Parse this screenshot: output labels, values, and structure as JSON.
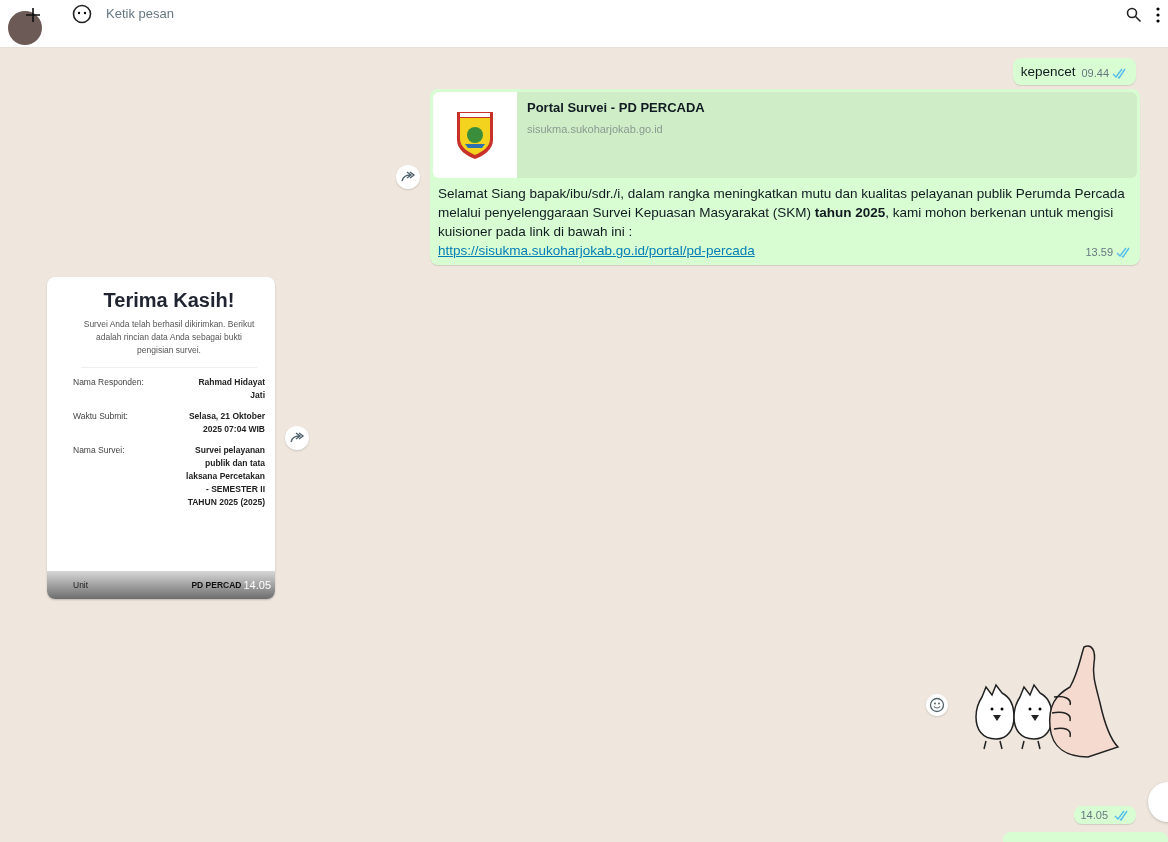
{
  "header": {
    "placeholder": "Ketik pesan"
  },
  "messages": [
    {
      "kind": "text",
      "outgoing": true,
      "text": "kepencet",
      "time": "09.44",
      "read": true
    },
    {
      "kind": "link",
      "outgoing": true,
      "forward": true,
      "preview": {
        "title": "Portal Survei - PD PERCADA",
        "domain": "sisukma.sukoharjokab.go.id"
      },
      "text": "Selamat Siang bapak/ibu/sdr./i, dalam rangka meningkatkan mutu dan kualitas pelayanan publik Perumda Percada melalui penyelenggaraan Survei Kepuasan Masyarakat (SKM) **tahun 2025**, kami mohon berkenan untuk mengisi kuisioner pada link di bawah ini :",
      "url": "https://sisukma.sukoharjokab.go.id/portal/pd-percada",
      "time": "13.59",
      "read": true
    },
    {
      "kind": "image",
      "outgoing": false,
      "forward": true,
      "time": "14.05",
      "screenshot": {
        "title": "Terima Kasih!",
        "subtitle": "Survei Anda telah berhasil dikirimkan. Berikut adalah rincian data Anda sebagai bukti pengisian survei.",
        "rows": [
          {
            "label": "Nama Responden:",
            "value": "Rahmad Hidayat Jati"
          },
          {
            "label": "Waktu Submit:",
            "value": "Selasa, 21 Oktober 2025 07:04 WIB"
          },
          {
            "label": "Nama Survei:",
            "value": "Survei pelayanan publik dan tata laksana Percetakan - SEMESTER II TAHUN 2025 (2025)"
          }
        ],
        "last_row": {
          "label": "Unit",
          "value": "PD PERCAD"
        }
      }
    },
    {
      "kind": "sticker",
      "outgoing": true,
      "reaction_button": true
    },
    {
      "kind": "time",
      "outgoing": true,
      "time": "14.05",
      "read": true
    },
    {
      "kind": "partial",
      "outgoing": true
    }
  ]
}
